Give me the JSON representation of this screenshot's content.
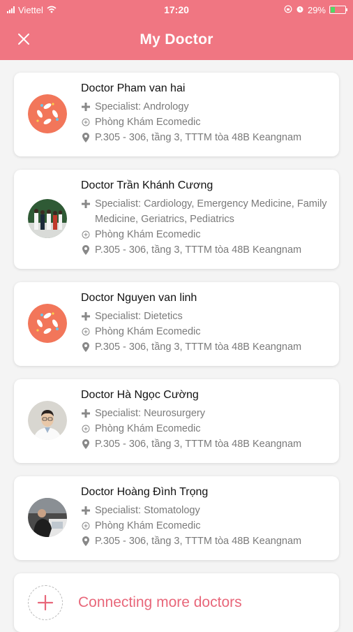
{
  "status_bar": {
    "carrier": "Viettel",
    "time": "17:20",
    "battery": "29%",
    "battery_level": 0.29
  },
  "header": {
    "title": "My Doctor"
  },
  "doctors": [
    {
      "name": "Doctor Pham van hai",
      "specialist": "Specialist: Andrology",
      "clinic": "Phòng Khám Ecomedic",
      "address": "P.305 - 306, tầng 3, TTTM tòa 48B Keangnam",
      "avatar": "logo-avatar"
    },
    {
      "name": "Doctor Trần Khánh Cương",
      "specialist": "Specialist: Cardiology, Emergency Medicine, Family Medicine, Geriatrics, Pediatrics",
      "clinic": "Phòng Khám Ecomedic",
      "address": "P.305 - 306, tầng 3, TTTM tòa 48B Keangnam",
      "avatar": "group-photo-avatar"
    },
    {
      "name": "Doctor Nguyen van linh",
      "specialist": "Specialist: Dietetics",
      "clinic": "Phòng Khám Ecomedic",
      "address": "P.305 - 306, tầng 3, TTTM tòa 48B Keangnam",
      "avatar": "logo-avatar"
    },
    {
      "name": "Doctor Hà Ngọc Cường",
      "specialist": "Specialist: Neurosurgery",
      "clinic": "Phòng Khám Ecomedic",
      "address": "P.305 - 306, tầng 3, TTTM tòa 48B Keangnam",
      "avatar": "portrait-avatar"
    },
    {
      "name": "Doctor Hoàng Đình Trọng",
      "specialist": "Specialist: Stomatology",
      "clinic": "Phòng Khám Ecomedic",
      "address": "P.305 - 306, tầng 3, TTTM tòa 48B Keangnam",
      "avatar": "office-photo-avatar"
    }
  ],
  "connect_more": {
    "label": "Connecting more doctors"
  },
  "colors": {
    "brand": "#f07682",
    "accent_text": "#e8677a",
    "secondary_text": "#7a7a7a"
  }
}
